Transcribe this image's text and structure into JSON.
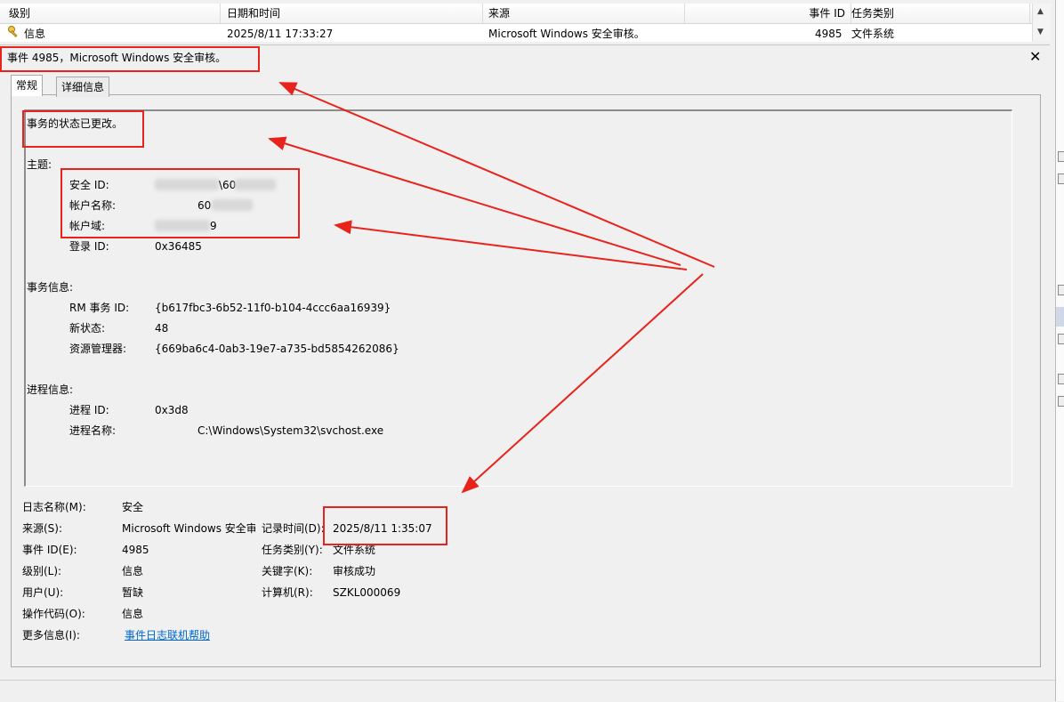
{
  "list": {
    "headers": {
      "level": "级别",
      "datetime": "日期和时间",
      "source": "来源",
      "event_id": "事件 ID",
      "task_category": "任务类别"
    },
    "row": {
      "level": "信息",
      "datetime": "2025/8/11 17:33:27",
      "source": "Microsoft Windows 安全审核。",
      "event_id": "4985",
      "task_category": "文件系统"
    }
  },
  "detail": {
    "title": "事件 4985，Microsoft Windows 安全审核。",
    "tabs": {
      "general": "常规",
      "details": "详细信息"
    },
    "description": {
      "summary": "事务的状态已更改。",
      "subject_heading": "主题:",
      "security_id_label": "安全 ID:",
      "security_id_value": "\\60",
      "account_name_label": "帐户名称:",
      "account_name_value": "60",
      "account_domain_label": "帐户域:",
      "account_domain_value": "9",
      "logon_id_label": "登录 ID:",
      "logon_id_value": "0x36485",
      "transaction_heading": "事务信息:",
      "rm_txn_label": "RM 事务 ID:",
      "rm_txn_value": "{b617fbc3-6b52-11f0-b104-4ccc6aa16939}",
      "new_state_label": "新状态:",
      "new_state_value": "48",
      "resource_mgr_label": "资源管理器:",
      "resource_mgr_value": "{669ba6c4-0ab3-19e7-a735-bd5854262086}",
      "process_heading": "进程信息:",
      "process_id_label": "进程 ID:",
      "process_id_value": "0x3d8",
      "process_name_label": "进程名称:",
      "process_name_value": "C:\\Windows\\System32\\svchost.exe"
    },
    "fields": {
      "log_name_label": "日志名称(M):",
      "log_name_value": "安全",
      "source_label": "来源(S):",
      "source_value": "Microsoft Windows 安全审",
      "logged_label": "记录时间(D):",
      "logged_value": "2025/8/11 1:35:07",
      "event_id_label": "事件 ID(E):",
      "event_id_value": "4985",
      "task_cat_label": "任务类别(Y):",
      "task_cat_value": "文件系统",
      "level_label": "级别(L):",
      "level_value": "信息",
      "keywords_label": "关键字(K):",
      "keywords_value": "审核成功",
      "user_label": "用户(U):",
      "user_value": "暂缺",
      "computer_label": "计算机(R):",
      "computer_value": "SZKL000069",
      "opcode_label": "操作代码(O):",
      "opcode_value": "信息",
      "more_info_label": "更多信息(I):",
      "more_info_link": "事件日志联机帮助"
    }
  },
  "colors": {
    "annotation": "#e8231c",
    "link": "#0066cc"
  },
  "icons": {
    "level_icon": "key-icon",
    "close": "close-icon"
  }
}
